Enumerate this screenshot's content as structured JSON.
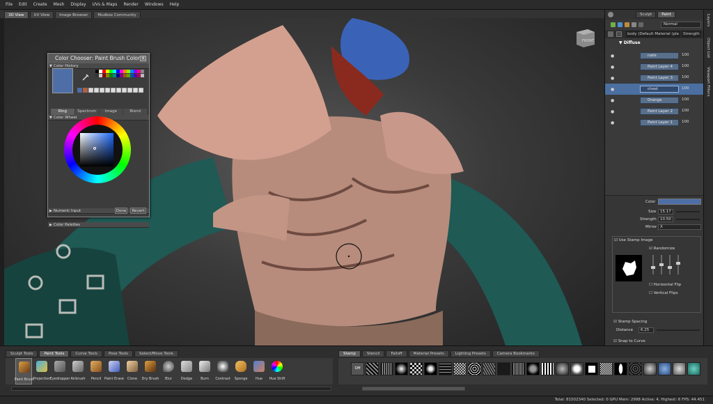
{
  "menu": [
    "File",
    "Edit",
    "Create",
    "Mesh",
    "Display",
    "UVs & Maps",
    "Render",
    "Windows",
    "Help"
  ],
  "view_tabs": [
    "3D View",
    "UV View",
    "Image Browser",
    "Mudbox Community"
  ],
  "viewport": {
    "cube_label": "FRONT"
  },
  "color_chooser": {
    "title": "Color Chooser: Paint Brush Color",
    "close": "x",
    "color_history": "Color History",
    "color_wheel": "Color Wheel",
    "tabs": [
      "Ring",
      "Spectrum",
      "Image",
      "Blend"
    ],
    "numeric_input": "Numeric Input",
    "color_palettes": "Color Palettes",
    "done": "Done",
    "revert": "Revert",
    "current_color": "#4d6ea6"
  },
  "right_side_tabs": [
    "Layers",
    "Object List",
    "Viewport Filters"
  ],
  "layers": {
    "tabs": [
      "Sculpt",
      "Paint"
    ],
    "blend_mode": "Normal",
    "material": "body (Default Material (ple",
    "channel": "Strength",
    "group": "Diffuse",
    "items": [
      {
        "name": "nails",
        "value": "100"
      },
      {
        "name": "Paint Layer 4",
        "value": "100"
      },
      {
        "name": "Paint Layer 3",
        "value": "100"
      },
      {
        "name": "chest",
        "value": "100"
      },
      {
        "name": "Orange",
        "value": "100"
      },
      {
        "name": "Paint Layer 2",
        "value": "100"
      },
      {
        "name": "Paint Layer 1",
        "value": "100"
      }
    ]
  },
  "properties": {
    "color_label": "Color",
    "size_label": "Size",
    "size": "15.17",
    "strength_label": "Strength",
    "strength": "10.50",
    "mirror_label": "Mirror",
    "mirror": "X",
    "use_stamp": "Use Stamp Image",
    "randomize": "Randomize",
    "hflip": "Horizontal Flip",
    "vflip": "Vertical Flips",
    "stamp_spacing": "Stamp Spacing",
    "distance_label": "Distance",
    "distance": "6.25",
    "snap": "Snap to Curve"
  },
  "tool_tabs": [
    "Sculpt Tools",
    "Paint Tools",
    "Curve Tools",
    "Pose Tools",
    "Select/Move Tools"
  ],
  "tools": [
    "Paint Brush",
    "Projection",
    "Eyedropper",
    "Airbrush",
    "Pencil",
    "Paint Erase",
    "Clone",
    "Dry Brush",
    "Blur",
    "Dodge",
    "Burn",
    "Contrast",
    "Sponge",
    "Hue",
    "Hue Shift"
  ],
  "stamp_tabs": [
    "Stamp",
    "Stencil",
    "Falloff",
    "Material Presets",
    "Lighting Presets",
    "Camera Bookmarks"
  ],
  "stamp_off": "Off",
  "status": "Total: 81502340  Selected: 0  GPU Mem: 2998  Active: 4, Highest: 6  FPS: 44.451"
}
